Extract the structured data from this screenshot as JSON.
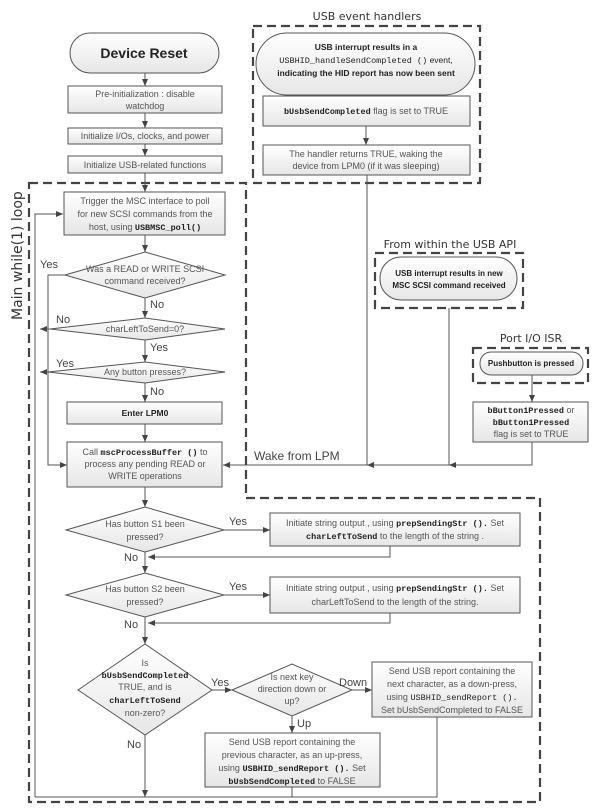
{
  "usb_handlers_title": "USB event handlers",
  "device_reset": "Device Reset",
  "preinit": [
    "Pre-initialization :  disable",
    "watchdog"
  ],
  "init_io": "Initialize I/Os, clocks, and power",
  "init_usb": "Initialize USB-related functions",
  "main_loop_label": "Main while(1) loop",
  "usb_irq": {
    "line1": "USB interrupt results in a",
    "code": "USBHID_handleSendCompleted ()",
    "suffix": " event,",
    "line3": "indicating the HID report has now been sent"
  },
  "flag_true": {
    "code": "bUsbSendCompleted",
    "text": "  flag is set to TRUE"
  },
  "handler_returns": [
    "The handler returns TRUE, waking the",
    "device from LPM0 (if it was sleeping)"
  ],
  "trigger": {
    "line1": "Trigger the MSC interface to poll",
    "line2": "for new SCSI commands from the",
    "prefix": "host, using ",
    "code": "USBMSC_poll()"
  },
  "d_rw": [
    "Was a READ or WRITE SCSI",
    "command received?"
  ],
  "d_char": "charLeftToSend=0?",
  "d_btn": "Any button presses?",
  "lpm0": "Enter LPM0",
  "call": {
    "prefix": "Call ",
    "code": "mscProcessBuffer ()",
    "suffix": " to",
    "line2": "process any pending READ or",
    "line3": "WRITE operations"
  },
  "usb_api": {
    "title": "From within the USB API",
    "lines": [
      "USB interrupt results in new",
      "MSC SCSI command received"
    ]
  },
  "port_isr": {
    "title": "Port I/O ISR",
    "stadium": "Pushbutton is pressed",
    "code1": "bButton1Pressed",
    "or": " or",
    "code2": "bButton1Pressed",
    "line3": "flag is set to TRUE"
  },
  "wake": "Wake from LPM",
  "s1": {
    "q": [
      "Has button S1 been",
      "pressed?"
    ],
    "prefix": "Initiate string output , using ",
    "code": "prepSendingStr ().",
    "suffix": "  Set",
    "code2": "charLeftToSend",
    "line2": "  to the length of the string ."
  },
  "s2": {
    "q": [
      "Has button S2 been",
      "pressed?"
    ],
    "prefix": "Initiate string output , using ",
    "code": "prepSendingStr ().",
    "suffix": "  Set",
    "line2": "charLeftToSend to the length of the string."
  },
  "d_send": {
    "l1": "Is",
    "code1": "bUsbSendCompleted",
    "l3": "TRUE, and is",
    "code2": "charLeftToSend",
    "l5": "non-zero?"
  },
  "d_dir": [
    "Is next key",
    "direction down or",
    "up?"
  ],
  "down_box": {
    "l1": "Send USB report containing the",
    "l2": "next character, as a down-press,",
    "prefix": "using ",
    "code": "USBHID_sendReport ().",
    "l4": "Set bUsbSendCompleted to FALSE"
  },
  "up_box": {
    "l1": "Send USB report containing the",
    "l2": "previous character, as an up-press,",
    "prefix": "using ",
    "code": "USBHID_sendReport ().",
    "suffix": "  Set",
    "code2": "bUsbSendCompleted",
    "l4": "  to FALSE"
  },
  "labels": {
    "yes": "Yes",
    "no": "No",
    "up": "Up",
    "down": "Down"
  }
}
